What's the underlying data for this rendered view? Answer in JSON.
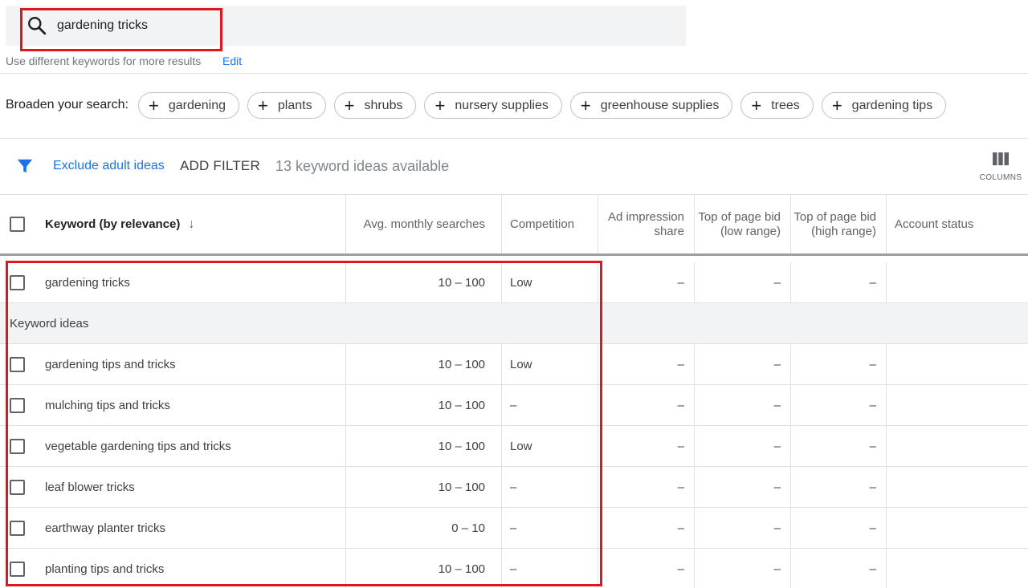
{
  "search": {
    "value": "gardening tricks"
  },
  "hint": {
    "text": "Use different keywords for more results",
    "edit_label": "Edit"
  },
  "broaden": {
    "label": "Broaden your search:",
    "chips": [
      "gardening",
      "plants",
      "shrubs",
      "nursery supplies",
      "greenhouse supplies",
      "trees",
      "gardening tips"
    ]
  },
  "filters": {
    "exclude_label": "Exclude adult ideas",
    "add_filter_label": "ADD FILTER",
    "available_text": "13 keyword ideas available",
    "columns_label": "COLUMNS"
  },
  "table": {
    "headers": {
      "keyword": "Keyword (by relevance)",
      "avg": "Avg. monthly searches",
      "competition": "Competition",
      "ad_share": "Ad impression share",
      "bid_low": "Top of page bid (low range)",
      "bid_high": "Top of page bid (high range)",
      "account": "Account status"
    },
    "provided": {
      "keyword": "gardening tricks",
      "avg": "10 – 100",
      "competition": "Low",
      "ad_share": "–",
      "bid_low": "–",
      "bid_high": "–",
      "account": ""
    },
    "group_label": "Keyword ideas",
    "ideas": [
      {
        "keyword": "gardening tips and tricks",
        "avg": "10 – 100",
        "competition": "Low",
        "ad_share": "–",
        "bid_low": "–",
        "bid_high": "–",
        "account": ""
      },
      {
        "keyword": "mulching tips and tricks",
        "avg": "10 – 100",
        "competition": "–",
        "ad_share": "–",
        "bid_low": "–",
        "bid_high": "–",
        "account": ""
      },
      {
        "keyword": "vegetable gardening tips and tricks",
        "avg": "10 – 100",
        "competition": "Low",
        "ad_share": "–",
        "bid_low": "–",
        "bid_high": "–",
        "account": ""
      },
      {
        "keyword": "leaf blower tricks",
        "avg": "10 – 100",
        "competition": "–",
        "ad_share": "–",
        "bid_low": "–",
        "bid_high": "–",
        "account": ""
      },
      {
        "keyword": "earthway planter tricks",
        "avg": "0 – 10",
        "competition": "–",
        "ad_share": "–",
        "bid_low": "–",
        "bid_high": "–",
        "account": ""
      },
      {
        "keyword": "planting tips and tricks",
        "avg": "10 – 100",
        "competition": "–",
        "ad_share": "–",
        "bid_low": "–",
        "bid_high": "–",
        "account": ""
      }
    ]
  },
  "colors": {
    "accent": "#1a73e8",
    "highlight": "#e3141c",
    "group_bg": "#f1f3f4"
  }
}
